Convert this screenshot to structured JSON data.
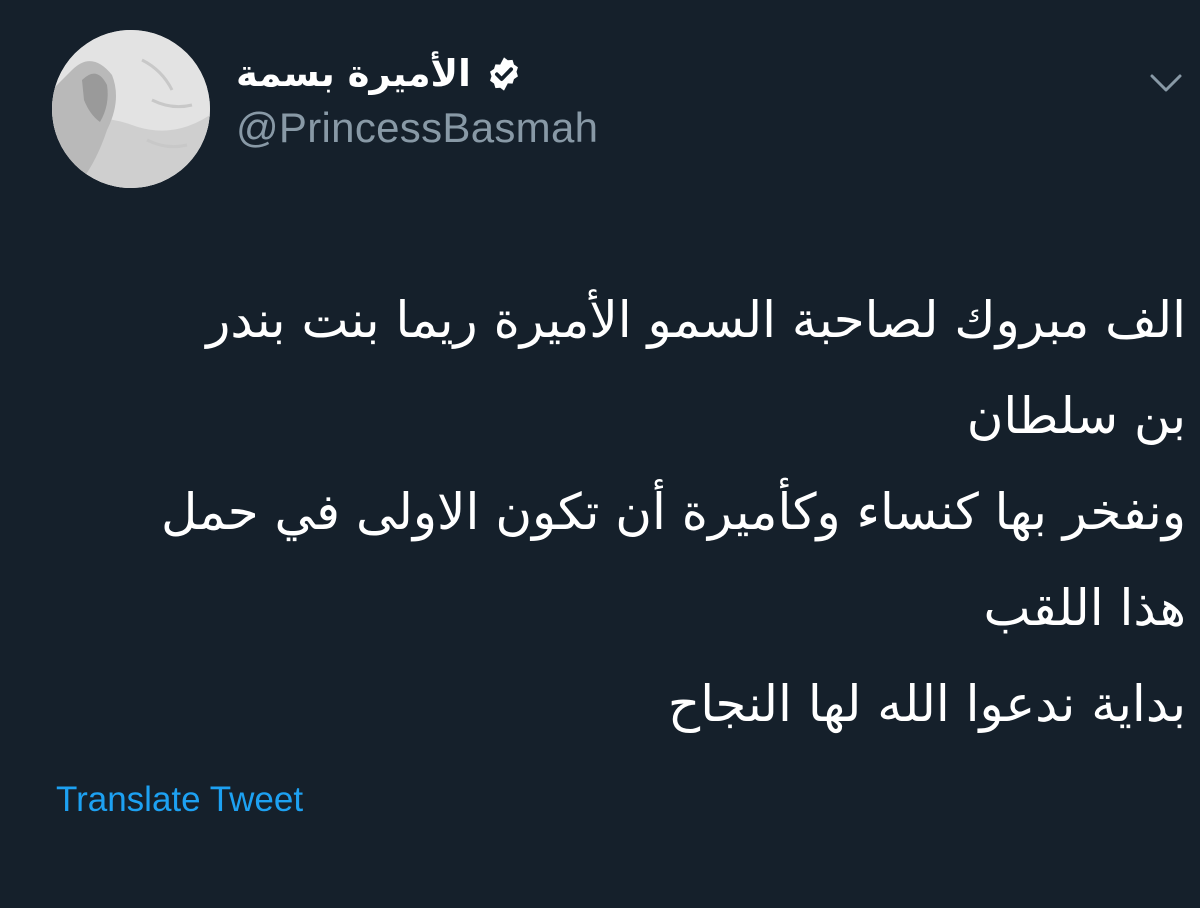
{
  "tweet": {
    "author": {
      "display_name": "الأميرة بسمة",
      "handle": "@PrincessBasmah",
      "verified": true,
      "avatar_icon": "profile-photo"
    },
    "menu_icon": "chevron-down-icon",
    "text_lines": [
      "الف مبروك لصاحبة السمو  الأميرة ريما بنت بندر",
      "بن سلطان",
      "ونفخر بها كنساء وكأميرة أن تكون الاولى في حمل",
      "هذا اللقب",
      "بداية ندعوا الله لها النجاح"
    ],
    "translate_label": "Translate Tweet"
  },
  "colors": {
    "background": "#15202b",
    "text": "#ffffff",
    "secondary": "#8899a6",
    "link": "#1da1f2"
  }
}
